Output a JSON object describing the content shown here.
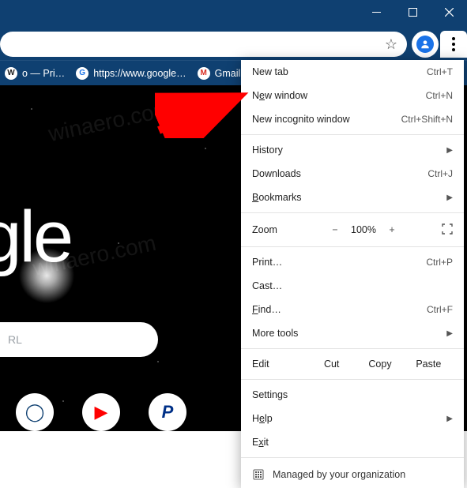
{
  "window": {
    "title": ""
  },
  "omnibox": {
    "value": ""
  },
  "bookmarks": {
    "items": [
      {
        "label": "o — Pri…",
        "favicon": "W"
      },
      {
        "label": "https://www.google…",
        "favicon": "G"
      },
      {
        "label": "Gmail",
        "favicon": "M"
      }
    ]
  },
  "page": {
    "logo": "oogle",
    "search_placeholder": "RL",
    "watermark": "winaero.com"
  },
  "menu": {
    "new_tab": {
      "label": "New tab",
      "u": "",
      "shortcut": "Ctrl+T"
    },
    "new_window": {
      "label_pre": "N",
      "label_u": "e",
      "label_post": "w window",
      "shortcut": "Ctrl+N"
    },
    "incognito": {
      "label": "New incognito window",
      "shortcut": "Ctrl+Shift+N"
    },
    "history": {
      "label": "History"
    },
    "downloads": {
      "label": "Downloads",
      "shortcut": "Ctrl+J"
    },
    "bookmarks": {
      "label_pre": "",
      "label_u": "B",
      "label_post": "ookmarks"
    },
    "zoom": {
      "label": "Zoom",
      "minus": "−",
      "value": "100%",
      "plus": "+"
    },
    "print": {
      "label": "Print…",
      "shortcut": "Ctrl+P"
    },
    "cast": {
      "label": "Cast…"
    },
    "find": {
      "label_pre": "",
      "label_u": "F",
      "label_post": "ind…",
      "shortcut": "Ctrl+F"
    },
    "more_tools": {
      "label": "More tools"
    },
    "edit": {
      "label": "Edit",
      "cut": "Cut",
      "copy": "Copy",
      "paste": "Paste"
    },
    "settings": {
      "label": "Settings"
    },
    "help": {
      "label_pre": "H",
      "label_u": "e",
      "label_post": "lp"
    },
    "exit": {
      "label_pre": "E",
      "label_u": "x",
      "label_post": "it"
    },
    "managed": {
      "label": "Managed by your organization"
    }
  }
}
